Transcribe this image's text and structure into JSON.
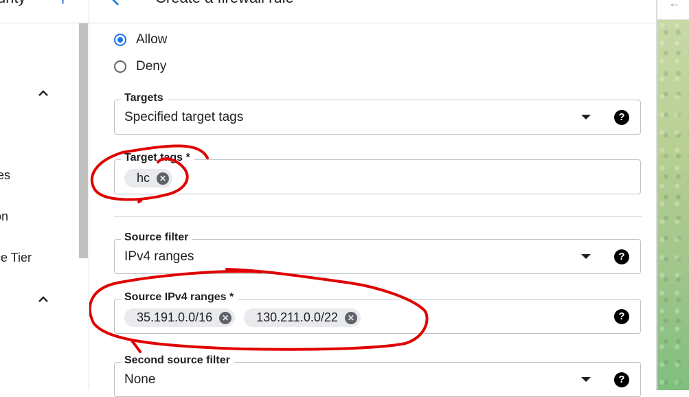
{
  "nav": {
    "title": "urity",
    "items": [
      "ies",
      "on",
      "ce Tier"
    ]
  },
  "panel": {
    "title": "Create a firewall rule"
  },
  "action": {
    "options": [
      "Allow",
      "Deny"
    ],
    "selected": "Allow"
  },
  "targets": {
    "label": "Targets",
    "value": "Specified target tags",
    "help": "?"
  },
  "target_tags": {
    "label": "Target tags *",
    "chips": [
      "hc"
    ]
  },
  "source_filter": {
    "label": "Source filter",
    "value": "IPv4 ranges",
    "help": "?"
  },
  "source_ranges": {
    "label": "Source IPv4 ranges *",
    "chips": [
      "35.191.0.0/16",
      "130.211.0.0/22"
    ],
    "help": "?"
  },
  "second_source_filter": {
    "label": "Second source filter",
    "value": "None",
    "help": "?"
  },
  "colors": {
    "accent": "#1a73e8",
    "annotation": "#e00000",
    "chip_bg": "#e8eaed"
  },
  "icons": [
    "add-icon",
    "chevron-up-icon",
    "back-arrow-icon",
    "dropdown-arrow-icon",
    "help-icon",
    "chip-remove-icon"
  ]
}
